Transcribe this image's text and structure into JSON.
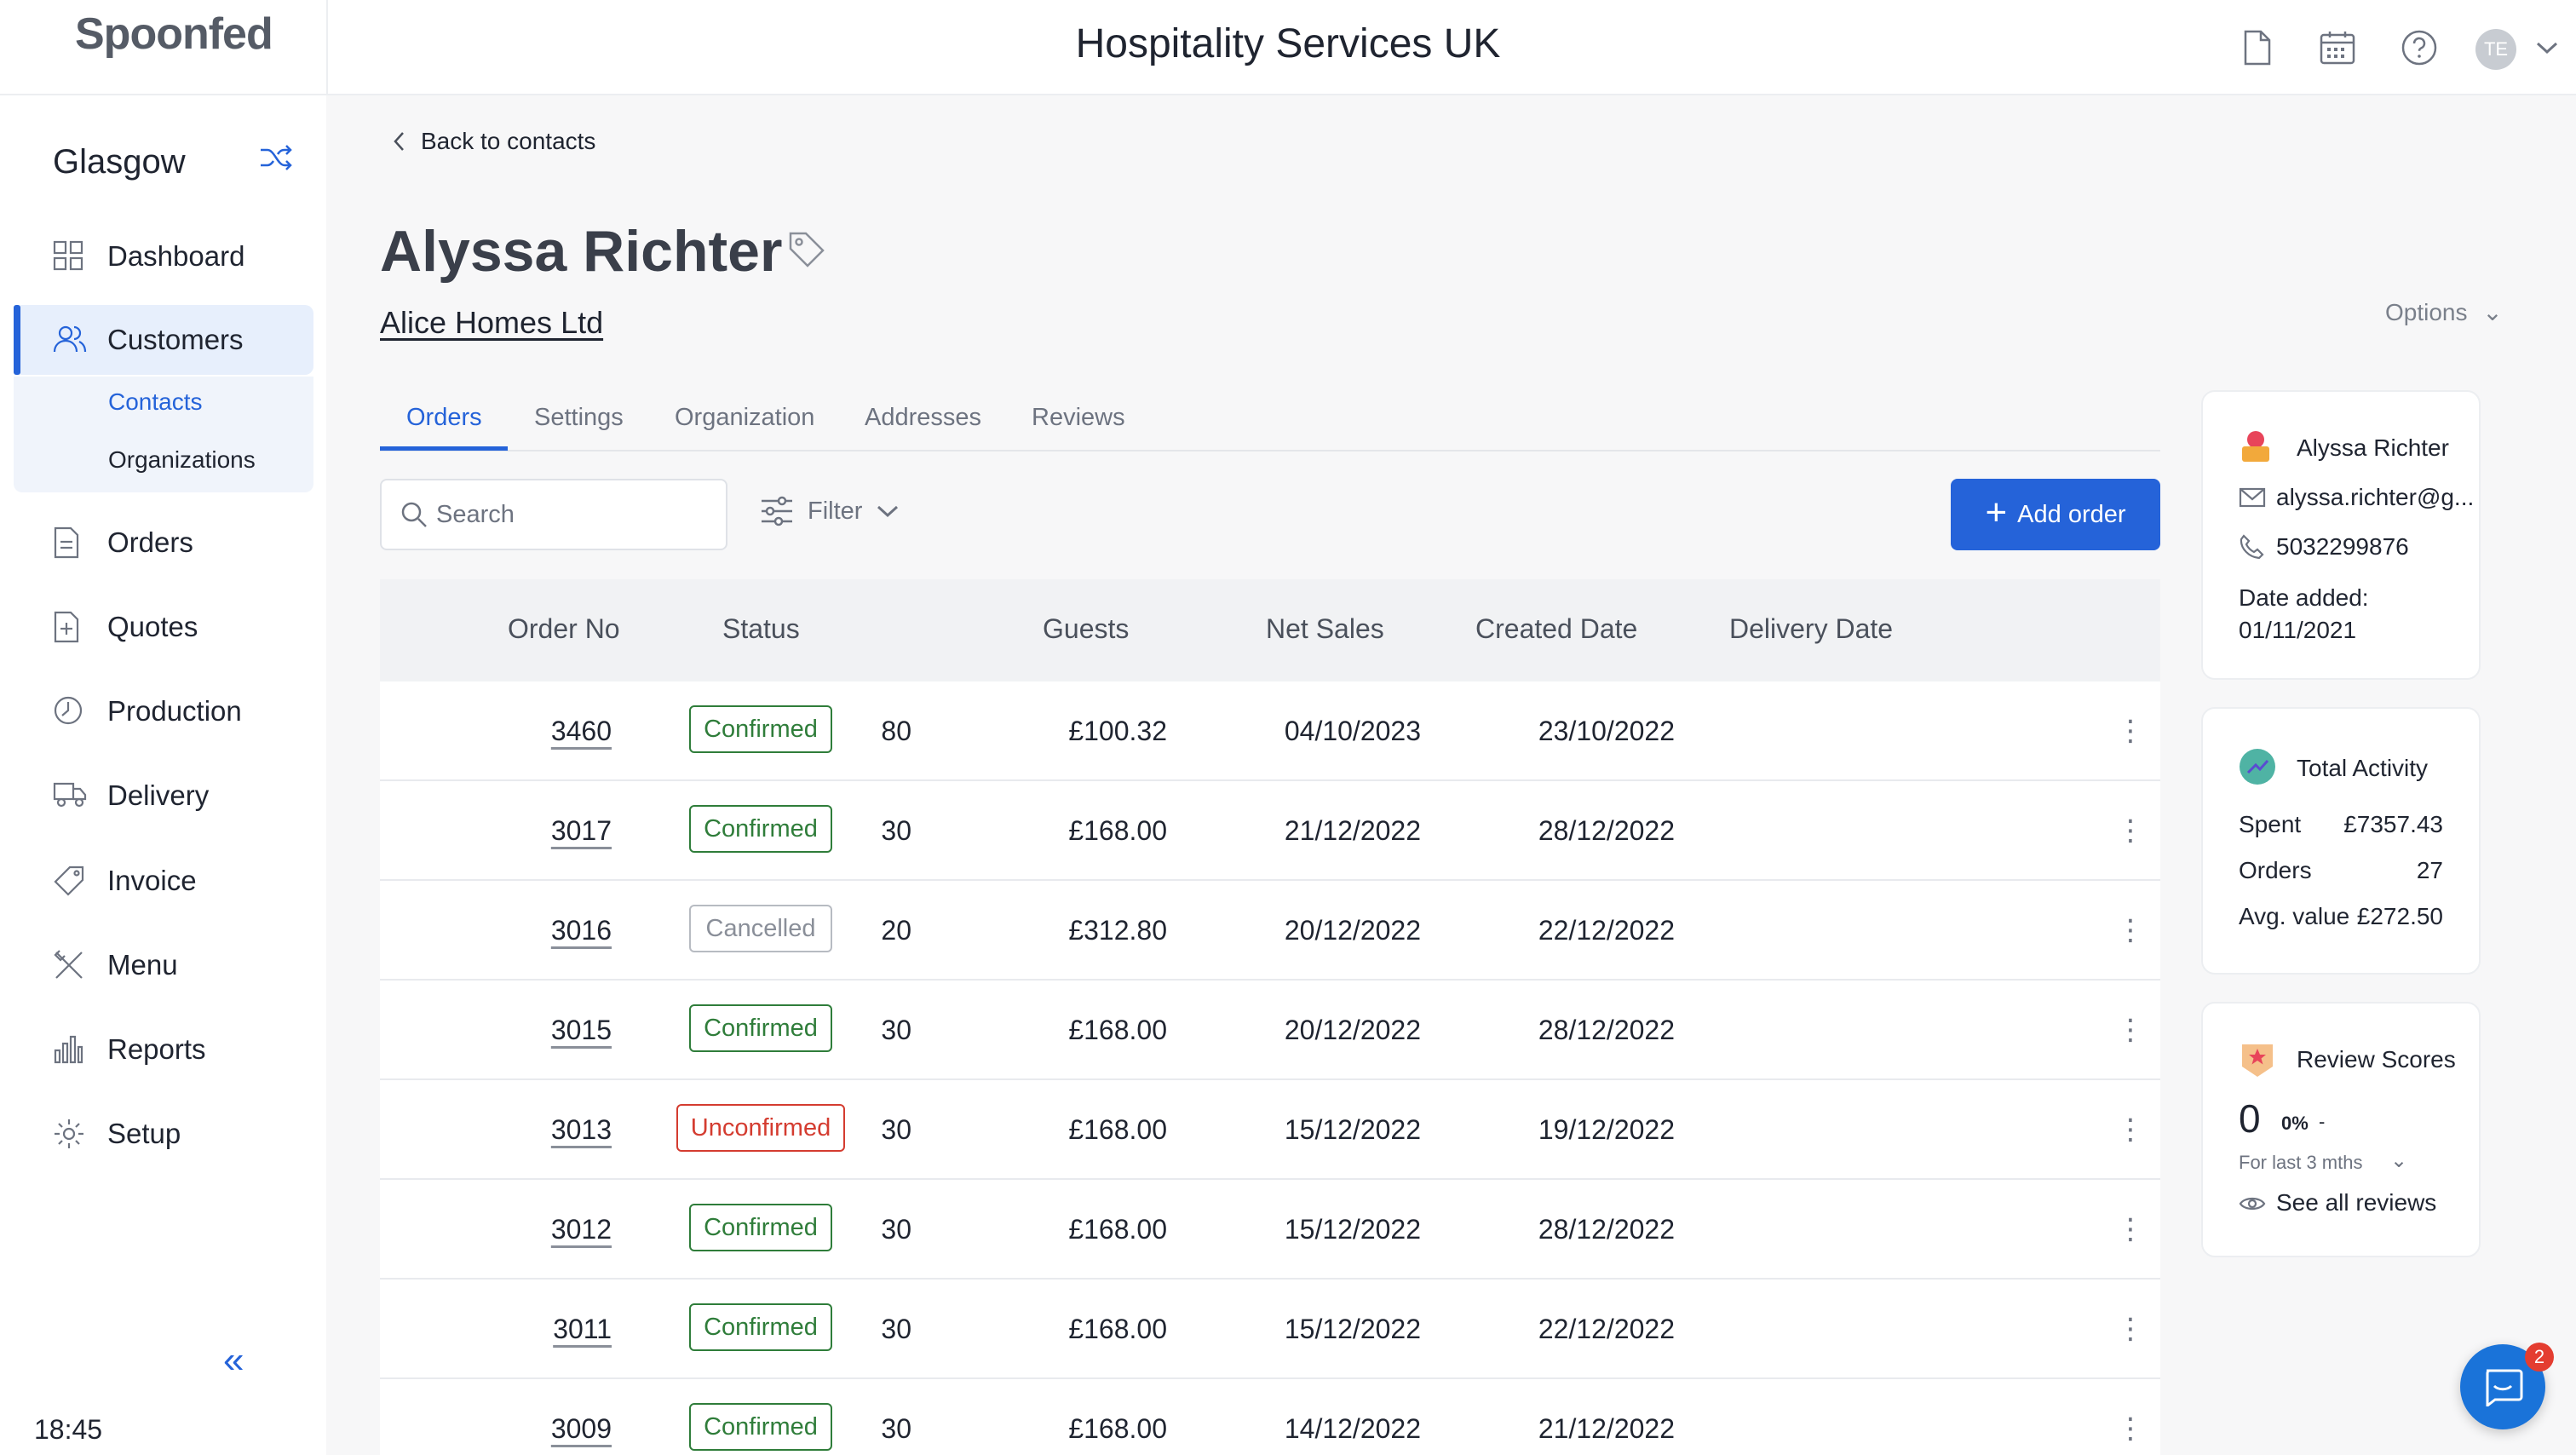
{
  "app": {
    "logo": "Spoonfed",
    "title": "Hospitality Services UK",
    "avatar_initials": "TE"
  },
  "sidebar": {
    "location": "Glasgow",
    "items": [
      {
        "label": "Dashboard",
        "icon": "grid-icon"
      },
      {
        "label": "Customers",
        "icon": "users-icon",
        "active": true
      },
      {
        "label": "Orders",
        "icon": "document-icon"
      },
      {
        "label": "Quotes",
        "icon": "quote-icon"
      },
      {
        "label": "Production",
        "icon": "clock-icon"
      },
      {
        "label": "Delivery",
        "icon": "truck-icon"
      },
      {
        "label": "Invoice",
        "icon": "tag-icon"
      },
      {
        "label": "Menu",
        "icon": "utensils-icon"
      },
      {
        "label": "Reports",
        "icon": "bar-chart-icon"
      },
      {
        "label": "Setup",
        "icon": "gear-icon"
      }
    ],
    "subitems": [
      {
        "label": "Contacts",
        "active": true
      },
      {
        "label": "Organizations"
      }
    ],
    "time": "18:45"
  },
  "page": {
    "back_label": "Back to contacts",
    "contact_name": "Alyssa Richter",
    "organization": "Alice Homes Ltd",
    "options_label": "Options"
  },
  "tabs": [
    "Orders",
    "Settings",
    "Organization",
    "Addresses",
    "Reviews"
  ],
  "toolbar": {
    "search_placeholder": "Search",
    "filter_label": "Filter",
    "add_label": "Add order"
  },
  "table": {
    "columns": [
      "Order No",
      "Status",
      "Guests",
      "Net Sales",
      "Created Date",
      "Delivery Date"
    ],
    "rows": [
      {
        "order_no": "3460",
        "status": "Confirmed",
        "guests": "80",
        "net_sales": "£100.32",
        "created": "04/10/2023",
        "delivery": "23/10/2022"
      },
      {
        "order_no": "3017",
        "status": "Confirmed",
        "guests": "30",
        "net_sales": "£168.00",
        "created": "21/12/2022",
        "delivery": "28/12/2022"
      },
      {
        "order_no": "3016",
        "status": "Cancelled",
        "guests": "20",
        "net_sales": "£312.80",
        "created": "20/12/2022",
        "delivery": "22/12/2022"
      },
      {
        "order_no": "3015",
        "status": "Confirmed",
        "guests": "30",
        "net_sales": "£168.00",
        "created": "20/12/2022",
        "delivery": "28/12/2022"
      },
      {
        "order_no": "3013",
        "status": "Unconfirmed",
        "guests": "30",
        "net_sales": "£168.00",
        "created": "15/12/2022",
        "delivery": "19/12/2022"
      },
      {
        "order_no": "3012",
        "status": "Confirmed",
        "guests": "30",
        "net_sales": "£168.00",
        "created": "15/12/2022",
        "delivery": "28/12/2022"
      },
      {
        "order_no": "3011",
        "status": "Confirmed",
        "guests": "30",
        "net_sales": "£168.00",
        "created": "15/12/2022",
        "delivery": "22/12/2022"
      },
      {
        "order_no": "3009",
        "status": "Confirmed",
        "guests": "30",
        "net_sales": "£168.00",
        "created": "14/12/2022",
        "delivery": "21/12/2022"
      }
    ]
  },
  "contact_card": {
    "name": "Alyssa Richter",
    "email": "alyssa.richter@g...",
    "phone": "5032299876",
    "date_added_label": "Date added:",
    "date_added": "01/11/2021"
  },
  "activity_card": {
    "title": "Total Activity",
    "spent_label": "Spent",
    "spent": "£7357.43",
    "orders_label": "Orders",
    "orders": "27",
    "avg_label": "Avg. value",
    "avg": "£272.50"
  },
  "reviews_card": {
    "title": "Review Scores",
    "score": "0",
    "percent": "0%",
    "trend": "-",
    "period": "For last 3 mths",
    "see_all": "See all reviews"
  },
  "messenger": {
    "badge_count": "2"
  },
  "colors": {
    "accent": "#2563d9",
    "confirmed": "#2f7d3a",
    "unconfirmed": "#d43c30",
    "cancelled": "#8a8f99"
  }
}
